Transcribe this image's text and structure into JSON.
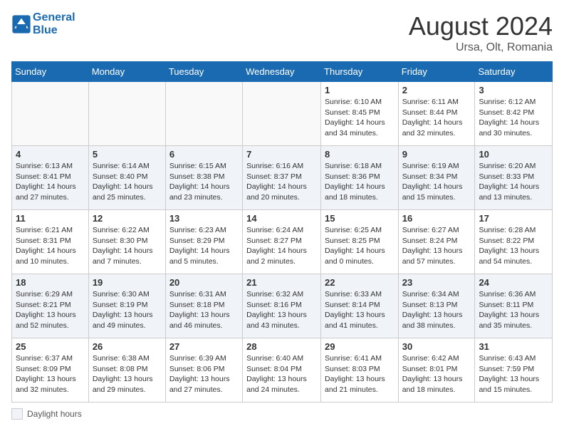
{
  "header": {
    "logo_line1": "General",
    "logo_line2": "Blue",
    "month_year": "August 2024",
    "location": "Ursa, Olt, Romania"
  },
  "days_of_week": [
    "Sunday",
    "Monday",
    "Tuesday",
    "Wednesday",
    "Thursday",
    "Friday",
    "Saturday"
  ],
  "weeks": [
    [
      {
        "day": "",
        "info": ""
      },
      {
        "day": "",
        "info": ""
      },
      {
        "day": "",
        "info": ""
      },
      {
        "day": "",
        "info": ""
      },
      {
        "day": "1",
        "info": "Sunrise: 6:10 AM\nSunset: 8:45 PM\nDaylight: 14 hours and 34 minutes."
      },
      {
        "day": "2",
        "info": "Sunrise: 6:11 AM\nSunset: 8:44 PM\nDaylight: 14 hours and 32 minutes."
      },
      {
        "day": "3",
        "info": "Sunrise: 6:12 AM\nSunset: 8:42 PM\nDaylight: 14 hours and 30 minutes."
      }
    ],
    [
      {
        "day": "4",
        "info": "Sunrise: 6:13 AM\nSunset: 8:41 PM\nDaylight: 14 hours and 27 minutes."
      },
      {
        "day": "5",
        "info": "Sunrise: 6:14 AM\nSunset: 8:40 PM\nDaylight: 14 hours and 25 minutes."
      },
      {
        "day": "6",
        "info": "Sunrise: 6:15 AM\nSunset: 8:38 PM\nDaylight: 14 hours and 23 minutes."
      },
      {
        "day": "7",
        "info": "Sunrise: 6:16 AM\nSunset: 8:37 PM\nDaylight: 14 hours and 20 minutes."
      },
      {
        "day": "8",
        "info": "Sunrise: 6:18 AM\nSunset: 8:36 PM\nDaylight: 14 hours and 18 minutes."
      },
      {
        "day": "9",
        "info": "Sunrise: 6:19 AM\nSunset: 8:34 PM\nDaylight: 14 hours and 15 minutes."
      },
      {
        "day": "10",
        "info": "Sunrise: 6:20 AM\nSunset: 8:33 PM\nDaylight: 14 hours and 13 minutes."
      }
    ],
    [
      {
        "day": "11",
        "info": "Sunrise: 6:21 AM\nSunset: 8:31 PM\nDaylight: 14 hours and 10 minutes."
      },
      {
        "day": "12",
        "info": "Sunrise: 6:22 AM\nSunset: 8:30 PM\nDaylight: 14 hours and 7 minutes."
      },
      {
        "day": "13",
        "info": "Sunrise: 6:23 AM\nSunset: 8:29 PM\nDaylight: 14 hours and 5 minutes."
      },
      {
        "day": "14",
        "info": "Sunrise: 6:24 AM\nSunset: 8:27 PM\nDaylight: 14 hours and 2 minutes."
      },
      {
        "day": "15",
        "info": "Sunrise: 6:25 AM\nSunset: 8:25 PM\nDaylight: 14 hours and 0 minutes."
      },
      {
        "day": "16",
        "info": "Sunrise: 6:27 AM\nSunset: 8:24 PM\nDaylight: 13 hours and 57 minutes."
      },
      {
        "day": "17",
        "info": "Sunrise: 6:28 AM\nSunset: 8:22 PM\nDaylight: 13 hours and 54 minutes."
      }
    ],
    [
      {
        "day": "18",
        "info": "Sunrise: 6:29 AM\nSunset: 8:21 PM\nDaylight: 13 hours and 52 minutes."
      },
      {
        "day": "19",
        "info": "Sunrise: 6:30 AM\nSunset: 8:19 PM\nDaylight: 13 hours and 49 minutes."
      },
      {
        "day": "20",
        "info": "Sunrise: 6:31 AM\nSunset: 8:18 PM\nDaylight: 13 hours and 46 minutes."
      },
      {
        "day": "21",
        "info": "Sunrise: 6:32 AM\nSunset: 8:16 PM\nDaylight: 13 hours and 43 minutes."
      },
      {
        "day": "22",
        "info": "Sunrise: 6:33 AM\nSunset: 8:14 PM\nDaylight: 13 hours and 41 minutes."
      },
      {
        "day": "23",
        "info": "Sunrise: 6:34 AM\nSunset: 8:13 PM\nDaylight: 13 hours and 38 minutes."
      },
      {
        "day": "24",
        "info": "Sunrise: 6:36 AM\nSunset: 8:11 PM\nDaylight: 13 hours and 35 minutes."
      }
    ],
    [
      {
        "day": "25",
        "info": "Sunrise: 6:37 AM\nSunset: 8:09 PM\nDaylight: 13 hours and 32 minutes."
      },
      {
        "day": "26",
        "info": "Sunrise: 6:38 AM\nSunset: 8:08 PM\nDaylight: 13 hours and 29 minutes."
      },
      {
        "day": "27",
        "info": "Sunrise: 6:39 AM\nSunset: 8:06 PM\nDaylight: 13 hours and 27 minutes."
      },
      {
        "day": "28",
        "info": "Sunrise: 6:40 AM\nSunset: 8:04 PM\nDaylight: 13 hours and 24 minutes."
      },
      {
        "day": "29",
        "info": "Sunrise: 6:41 AM\nSunset: 8:03 PM\nDaylight: 13 hours and 21 minutes."
      },
      {
        "day": "30",
        "info": "Sunrise: 6:42 AM\nSunset: 8:01 PM\nDaylight: 13 hours and 18 minutes."
      },
      {
        "day": "31",
        "info": "Sunrise: 6:43 AM\nSunset: 7:59 PM\nDaylight: 13 hours and 15 minutes."
      }
    ]
  ],
  "footer": {
    "daylight_label": "Daylight hours"
  }
}
